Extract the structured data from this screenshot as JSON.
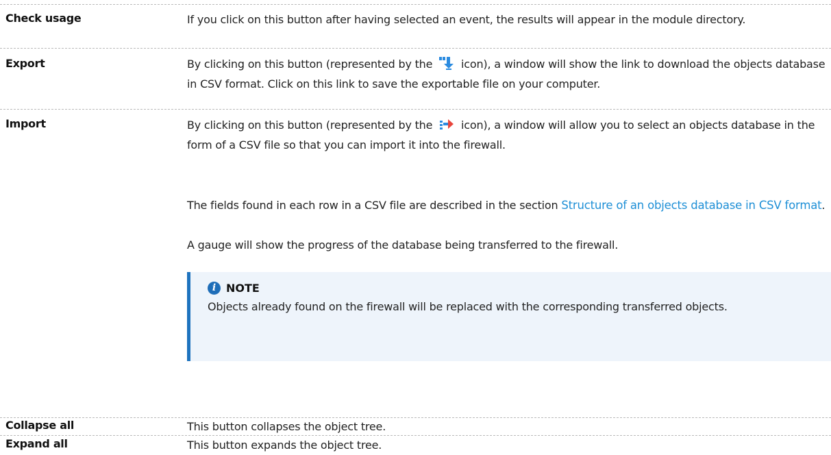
{
  "rows": [
    {
      "term": "Check usage",
      "desc": "If you click on this button after having selected an event, the results will appear in the module directory."
    },
    {
      "term": "Export",
      "desc_before": "By clicking on this button (represented by the",
      "desc_after": "icon), a window will show the link to download the objects database in CSV format. Click on this link to save the exportable file on your computer.",
      "icon": "export-icon"
    },
    {
      "term": "Import",
      "desc_before": "By clicking on this button (represented by the",
      "desc_after": "icon), a window will allow you to select an objects database in the form of a CSV file so that you can import it into the firewall.",
      "icon": "import-icon",
      "para2_before": "The fields found in each row in a CSV file are described in the section",
      "para2_link": "Structure of an objects database in CSV format",
      "para2_after": ".",
      "para3": "A gauge will show the progress of the database being transferred to the firewall.",
      "note": {
        "title": "NOTE",
        "icon": "info-icon",
        "text": "Objects already found on the firewall will be replaced with the corresponding transferred objects."
      }
    },
    {
      "term": "Collapse all",
      "desc": "This button collapses the object tree."
    },
    {
      "term": "Expand all",
      "desc": "This button expands the object tree."
    }
  ],
  "colors": {
    "link": "#1e8fd6",
    "note_bar": "#1e73be",
    "note_bg": "#eef4fb",
    "row_border": "#b9b9b9"
  }
}
